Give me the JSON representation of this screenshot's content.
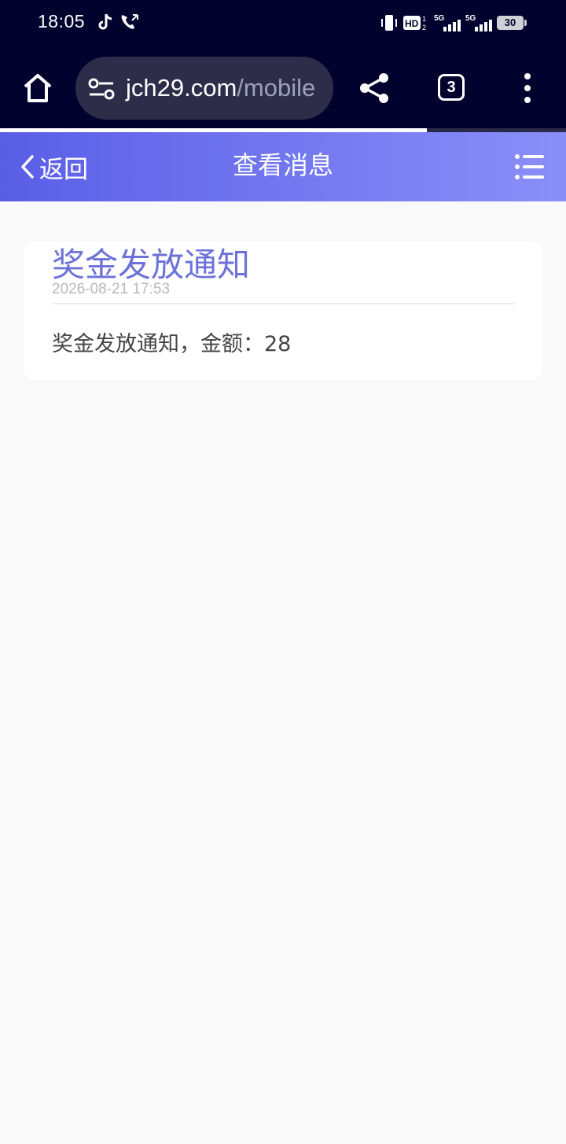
{
  "status_bar": {
    "time": "18:05",
    "battery": "30",
    "network_1": "5G",
    "network_2": "5G",
    "hd_label": "HD"
  },
  "browser": {
    "url_domain": "jch29.com",
    "url_path": "/mobile",
    "tab_count": "3",
    "load_progress": 0.754
  },
  "header": {
    "back_label": "返回",
    "title": "查看消息"
  },
  "message": {
    "title": "奖金发放通知",
    "time": "2026-08-21 17:53",
    "content": "奖金发放通知，金额：28"
  },
  "colors": {
    "chrome_bg": "#02022e",
    "header_gradient_start": "#5a5ee6",
    "header_gradient_end": "#8a8ff8",
    "title_color": "#6d72d8",
    "page_bg": "#f9f9f9"
  }
}
